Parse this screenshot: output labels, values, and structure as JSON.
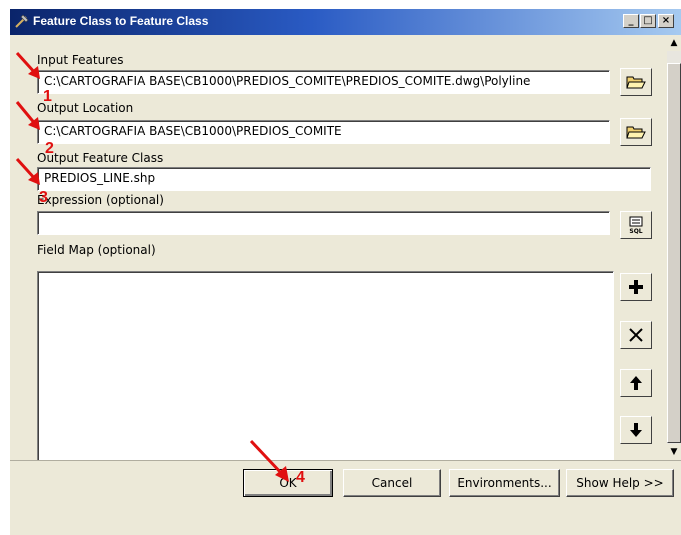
{
  "window": {
    "title": "Feature Class to Feature Class",
    "controls": [
      "minimize-icon",
      "maximize-icon",
      "close-icon"
    ]
  },
  "form": {
    "input_features_label": "Input Features",
    "input_features_value": "C:\\CARTOGRAFIA BASE\\CB1000\\PREDIOS_COMITE\\PREDIOS_COMITE.dwg\\Polyline",
    "output_location_label": "Output Location",
    "output_location_value": "C:\\CARTOGRAFIA BASE\\CB1000\\PREDIOS_COMITE",
    "output_feature_class_label": "Output Feature Class",
    "output_feature_class_value": "PREDIOS_LINE.shp",
    "expression_label": "Expression (optional)",
    "expression_value": "",
    "field_map_label": "Field Map (optional)"
  },
  "icons": {
    "browse": "folder-open-icon",
    "sql": "sql-icon",
    "add": "plus-icon",
    "remove": "x-icon",
    "up": "arrow-up-icon",
    "down": "arrow-down-icon"
  },
  "buttons": {
    "ok": "OK",
    "cancel": "Cancel",
    "environments": "Environments...",
    "show_help": "Show Help >>"
  },
  "annotations": {
    "n1a": "1",
    "n1b": "1",
    "n2": "2",
    "n3": "3",
    "n4": "4",
    "color": "#e01010"
  }
}
